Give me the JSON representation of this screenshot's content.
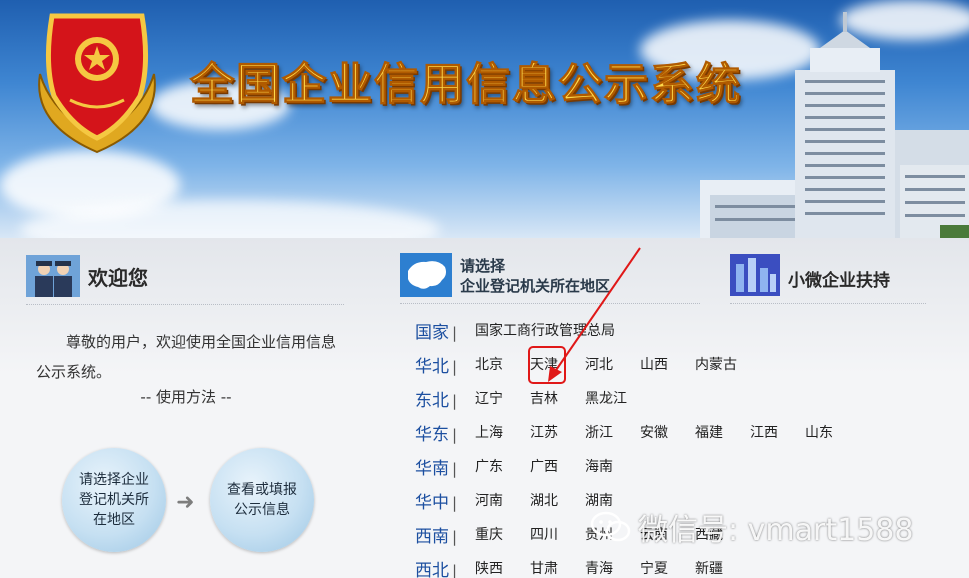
{
  "banner": {
    "title": "全国企业信用信息公示系统"
  },
  "welcome": {
    "title": "欢迎您",
    "text": "尊敬的用户，欢迎使用全国企业信用信息公示系统。",
    "usage": "-- 使用方法 --",
    "step1": "请选择企业登记机关所在地区",
    "step2": "查看或填报公示信息"
  },
  "select": {
    "title_line1": "请选择",
    "title_line2": "企业登记机关所在地区"
  },
  "regions": [
    {
      "name": "国家",
      "areas": [
        "国家工商行政管理总局"
      ]
    },
    {
      "name": "华北",
      "areas": [
        "北京",
        "天津",
        "河北",
        "山西",
        "内蒙古"
      ]
    },
    {
      "name": "东北",
      "areas": [
        "辽宁",
        "吉林",
        "黑龙江"
      ]
    },
    {
      "name": "华东",
      "areas": [
        "上海",
        "江苏",
        "浙江",
        "安徽",
        "福建",
        "江西",
        "山东"
      ]
    },
    {
      "name": "华南",
      "areas": [
        "广东",
        "广西",
        "海南"
      ]
    },
    {
      "name": "华中",
      "areas": [
        "河南",
        "湖北",
        "湖南"
      ]
    },
    {
      "name": "西南",
      "areas": [
        "重庆",
        "四川",
        "贵州",
        "云南",
        "西藏"
      ]
    },
    {
      "name": "西北",
      "areas": [
        "陕西",
        "甘肃",
        "青海",
        "宁夏",
        "新疆"
      ]
    }
  ],
  "support": {
    "title": "小微企业扶持"
  },
  "watermark": {
    "text": "微信号: vmart1588"
  },
  "colors": {
    "region_blue": "#1c4fa0",
    "highlight_red": "#e01818",
    "title_gold": "#ffd94a"
  }
}
